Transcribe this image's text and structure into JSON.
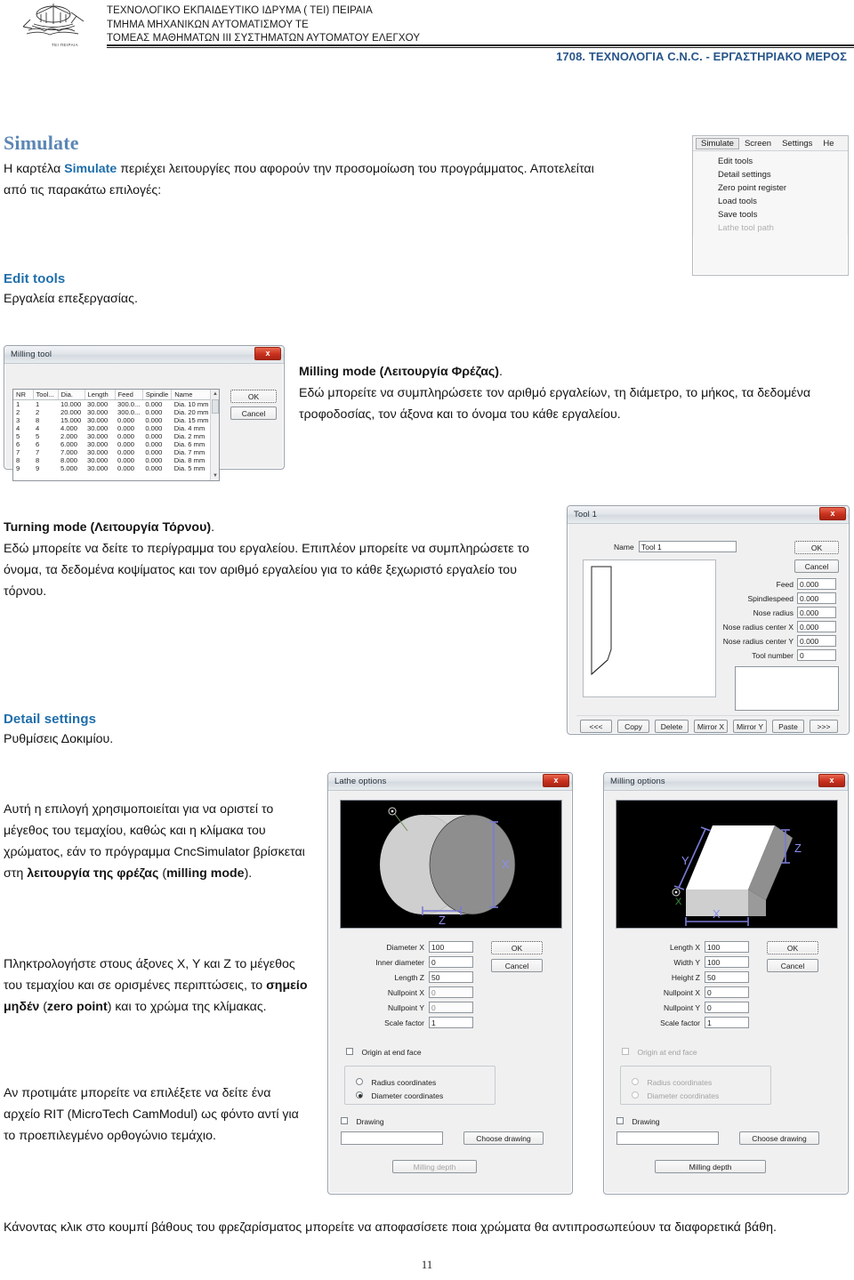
{
  "header": {
    "institution_lines": [
      "ΤΕΧΝΟΛΟΓΙΚΟ ΕΚΠΑΙΔΕΥΤΙΚΟ ΙΔΡΥΜΑ ( ΤΕΙ)  ΠΕΙΡΑΙΑ",
      "ΤΜΗΜΑ ΜΗΧΑΝΙΚΩΝ  ΑΥΤΟΜΑΤΙΣΜΟΥ  ΤΕ",
      "ΤΟΜΕΑΣ ΜΑΘΗΜΑΤΩΝ ΙΙΙ  ΣΥΣΤΗΜΑΤΩΝ  ΑΥΤΟΜΑΤΟΥ  ΕΛΕΓΧΟΥ"
    ],
    "logo_caption": "ΤΕΙ ΠΕΙΡΑΙΑ",
    "course_title": "1708. ΤΕΧΝΟΛΟΓΙΑ C.N.C. - ΕΡΓΑΣΤΗΡΙΑΚΟ ΜΕΡΟΣ"
  },
  "sections": {
    "simulate": {
      "heading": "Simulate",
      "body_before": "Η καρτέλα ",
      "body_highlight": "Simulate",
      "body_after": " περιέχει λειτουργίες που αφορούν την προσομοίωση του προγράμματος. Αποτελείται από τις παρακάτω επιλογές:"
    },
    "edit_tools": {
      "heading": "Edit tools",
      "body": "Εργαλεία επεξεργασίας."
    },
    "milling_mode": {
      "heading": "Milling mode (Λειτουργία Φρέζας)",
      "heading_tail": ".",
      "body": "Εδώ μπορείτε να συμπληρώσετε τον αριθμό εργαλείων, τη διάμετρο, το μήκος, τα δεδομένα τροφοδοσίας, τον άξονα και το όνομα του κάθε εργαλείου."
    },
    "turning_mode": {
      "heading": "Turning mode (Λειτουργία Τόρνου)",
      "heading_tail": ".",
      "body": "Εδώ μπορείτε να δείτε το περίγραμμα του εργαλείου. Επιπλέον μπορείτε να συμπληρώσετε το όνομα, τα δεδομένα κοψίματος και τον αριθμό εργαλείου για το κάθε ξεχωριστό εργαλείο του τόρνου."
    },
    "detail_settings": {
      "heading": "Detail settings",
      "body": "Ρυθμίσεις Δοκιμίου.",
      "para2_a": "Αυτή η επιλογή χρησιμοποιείται για να οριστεί το μέγεθος του τεμαχίου, καθώς και η κλίμακα του χρώματος, εάν το πρόγραμμα CncSimulator βρίσκεται στη ",
      "para2_b": "λειτουργία της φρέζας",
      "para2_c": " (",
      "para2_d": "milling mode",
      "para2_e": ").",
      "para3_a": "Πληκτρολογήστε στους άξονες X, Y και Z το μέγεθος του τεμαχίου και σε ορισμένες περιπτώσεις, το ",
      "para3_b": "σημείο μηδέν",
      "para3_c": " (",
      "para3_d": "zero point",
      "para3_e": ") και το χρώμα της κλίμακας.",
      "para4": "Αν προτιμάτε μπορείτε να επιλέξετε να δείτε ένα αρχείο RIT (MicroTech CamModul) ως φόντο αντί για το προεπιλεγμένο ορθογώνιο τεμάχιο."
    },
    "bottom_paragraph": "Κάνοντας κλικ στο κουμπί βάθους του φρεζαρίσματος μπορείτε να αποφασίσετε ποια χρώματα θα αντιπροσωπεύουν τα διαφορετικά βάθη."
  },
  "page_number": "11",
  "menu_simulate": {
    "menubar": [
      "Simulate",
      "Screen",
      "Settings",
      "He"
    ],
    "selected": "Simulate",
    "items": [
      {
        "label": "Edit tools",
        "disabled": false
      },
      {
        "label": "Detail settings",
        "disabled": false
      },
      {
        "label": "Zero point register",
        "disabled": false
      },
      {
        "label": "Load tools",
        "disabled": false
      },
      {
        "label": "Save tools",
        "disabled": false
      },
      {
        "label": "Lathe tool path",
        "disabled": true
      }
    ]
  },
  "dlg_milling_tool": {
    "title": "Milling tool",
    "close": "x",
    "columns": [
      "NR",
      "Tool...",
      "Dia.",
      "Length",
      "Feed",
      "Spindle",
      "Name"
    ],
    "rows": [
      [
        "1",
        "1",
        "10.000",
        "30.000",
        "300.0...",
        "0.000",
        "Dia. 10 mm"
      ],
      [
        "2",
        "2",
        "20.000",
        "30.000",
        "300.0...",
        "0.000",
        "Dia. 20 mm"
      ],
      [
        "3",
        "8",
        "15.000",
        "30.000",
        "0.000",
        "0.000",
        "Dia. 15 mm"
      ],
      [
        "4",
        "4",
        "4.000",
        "30.000",
        "0.000",
        "0.000",
        "Dia. 4 mm"
      ],
      [
        "5",
        "5",
        "2.000",
        "30.000",
        "0.000",
        "0.000",
        "Dia. 2 mm"
      ],
      [
        "6",
        "6",
        "6.000",
        "30.000",
        "0.000",
        "0.000",
        "Dia. 6 mm"
      ],
      [
        "7",
        "7",
        "7.000",
        "30.000",
        "0.000",
        "0.000",
        "Dia. 7 mm"
      ],
      [
        "8",
        "8",
        "8.000",
        "30.000",
        "0.000",
        "0.000",
        "Dia. 8 mm"
      ],
      [
        "9",
        "9",
        "5.000",
        "30.000",
        "0.000",
        "0.000",
        "Dia. 5 mm"
      ]
    ],
    "ok": "OK",
    "cancel": "Cancel"
  },
  "dlg_tool1": {
    "title": "Tool 1",
    "close": "x",
    "name_label": "Name",
    "name_value": "Tool 1",
    "ok": "OK",
    "cancel": "Cancel",
    "fields": [
      {
        "label": "Feed",
        "value": "0.000"
      },
      {
        "label": "Spindlespeed",
        "value": "0.000"
      },
      {
        "label": "Nose radius",
        "value": "0.000"
      },
      {
        "label": "Nose radius center X",
        "value": "0.000"
      },
      {
        "label": "Nose radius center Y",
        "value": "0.000"
      },
      {
        "label": "Tool number",
        "value": "0"
      }
    ],
    "buttons": [
      "<<<",
      "Copy",
      "Delete",
      "Mirror X",
      "Mirror Y",
      "Paste",
      ">>>"
    ]
  },
  "dlg_lathe": {
    "title": "Lathe options",
    "close": "x",
    "axis_labels": {
      "x": "X",
      "z": "Z"
    },
    "fields": [
      {
        "label": "Diameter X",
        "value": "100",
        "disabled": false
      },
      {
        "label": "Inner diameter",
        "value": "0",
        "disabled": false
      },
      {
        "label": "Length  Z",
        "value": "50",
        "disabled": false
      },
      {
        "label": "Nullpoint X",
        "value": "0",
        "disabled": true
      },
      {
        "label": "Nullpoint Y",
        "value": "0",
        "disabled": true
      },
      {
        "label": "Scale factor",
        "value": "1",
        "disabled": false
      }
    ],
    "ok": "OK",
    "cancel": "Cancel",
    "origin_checkbox": {
      "label": "Origin at end face",
      "checked": false,
      "disabled": false
    },
    "radio_radius": {
      "label": "Radius coordinates",
      "selected": false,
      "disabled": false
    },
    "radio_diameter": {
      "label": "Diameter coordinates",
      "selected": true,
      "disabled": false
    },
    "drawing_checkbox": {
      "label": "Drawing",
      "checked": false
    },
    "drawing_value": "",
    "choose_drawing": "Choose drawing",
    "milling_depth": {
      "label": "Milling depth",
      "disabled": true
    }
  },
  "dlg_milling_opt": {
    "title": "Milling options",
    "close": "x",
    "axis_labels": {
      "x": "X",
      "y": "Y",
      "z": "Z"
    },
    "fields": [
      {
        "label": "Length X",
        "value": "100",
        "disabled": false
      },
      {
        "label": "Width Y",
        "value": "100",
        "disabled": false
      },
      {
        "label": "Height Z",
        "value": "50",
        "disabled": false
      },
      {
        "label": "Nullpoint X",
        "value": "0",
        "disabled": false
      },
      {
        "label": "Nullpoint Y",
        "value": "0",
        "disabled": false
      },
      {
        "label": "Scale factor",
        "value": "1",
        "disabled": false
      }
    ],
    "ok": "OK",
    "cancel": "Cancel",
    "origin_checkbox": {
      "label": "Origin at end face",
      "checked": false,
      "disabled": true
    },
    "radio_radius": {
      "label": "Radius coordinates",
      "selected": false,
      "disabled": true
    },
    "radio_diameter": {
      "label": "Diameter coordinates",
      "selected": false,
      "disabled": true
    },
    "drawing_checkbox": {
      "label": "Drawing",
      "checked": false
    },
    "drawing_value": "",
    "choose_drawing": "Choose drawing",
    "milling_depth": {
      "label": "Milling depth",
      "disabled": false
    }
  },
  "colors": {
    "title_blue": "#5b86b5",
    "heading_blue": "#1f6eab",
    "course_blue": "#27558a",
    "dialog_close_red": "#c9301d"
  }
}
